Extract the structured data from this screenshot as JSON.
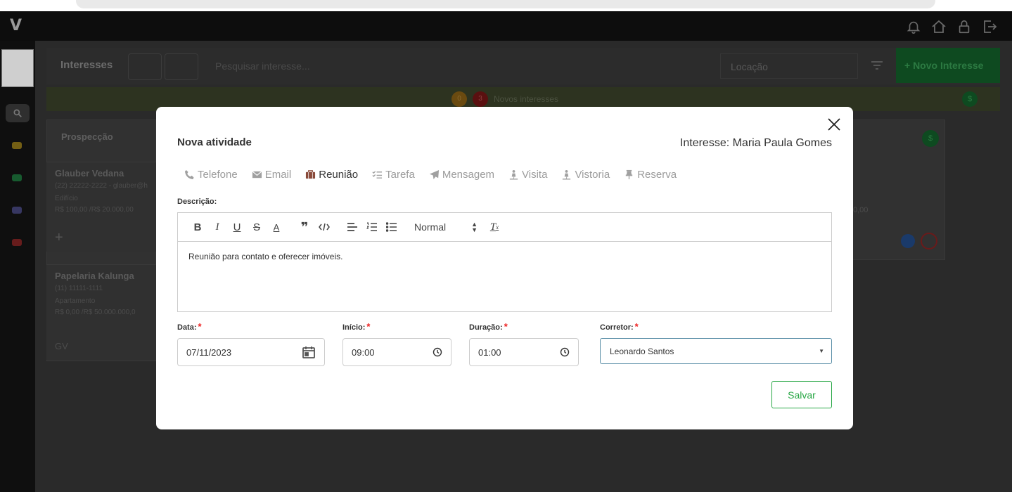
{
  "app": {
    "logo": "V"
  },
  "header": {
    "title": "Interesses",
    "search_placeholder": "Pesquisar interesse...",
    "filter_select": "Locação",
    "new_button": "+ Novo Interesse"
  },
  "banner": {
    "badge_a": "0",
    "badge_b": "3",
    "text": "Novos interesses"
  },
  "board": {
    "column_title": "Prospecção",
    "cards": [
      {
        "name": "Glauber Vedana",
        "contact": "(22) 22222-2222 - glauber@h",
        "type": "Edifício",
        "price": "R$ 100,00 /R$ 20.000,00"
      },
      {
        "name": "Papelaria Kalunga",
        "contact": "(11) 11111-1111",
        "type": "Apartamento",
        "price": "R$ 0,00 /R$ 50.000.000,0",
        "initials": "GV"
      }
    ],
    "right_price": "0,00"
  },
  "modal": {
    "title": "Nova atividade",
    "subtitle": "Interesse: Maria Paula Gomes",
    "tabs": [
      {
        "label": "Telefone",
        "icon": "phone-icon"
      },
      {
        "label": "Email",
        "icon": "envelope-icon"
      },
      {
        "label": "Reunião",
        "icon": "briefcase-icon"
      },
      {
        "label": "Tarefa",
        "icon": "tasks-icon"
      },
      {
        "label": "Mensagem",
        "icon": "paper-plane-icon"
      },
      {
        "label": "Visita",
        "icon": "walking-icon"
      },
      {
        "label": "Vistoria",
        "icon": "walking-icon"
      },
      {
        "label": "Reserva",
        "icon": "pin-icon"
      }
    ],
    "active_tab": "Reunião",
    "description_label": "Descrição:",
    "editor": {
      "heading_select": "Normal",
      "content": "Reunião para contato e oferecer imóveis."
    },
    "fields": {
      "date_label": "Data:",
      "date_value": "07/11/2023",
      "start_label": "Início:",
      "start_value": "09:00",
      "duration_label": "Duração:",
      "duration_value": "01:00",
      "broker_label": "Corretor:",
      "broker_value": "Leonardo Santos"
    },
    "save_label": "Salvar"
  }
}
